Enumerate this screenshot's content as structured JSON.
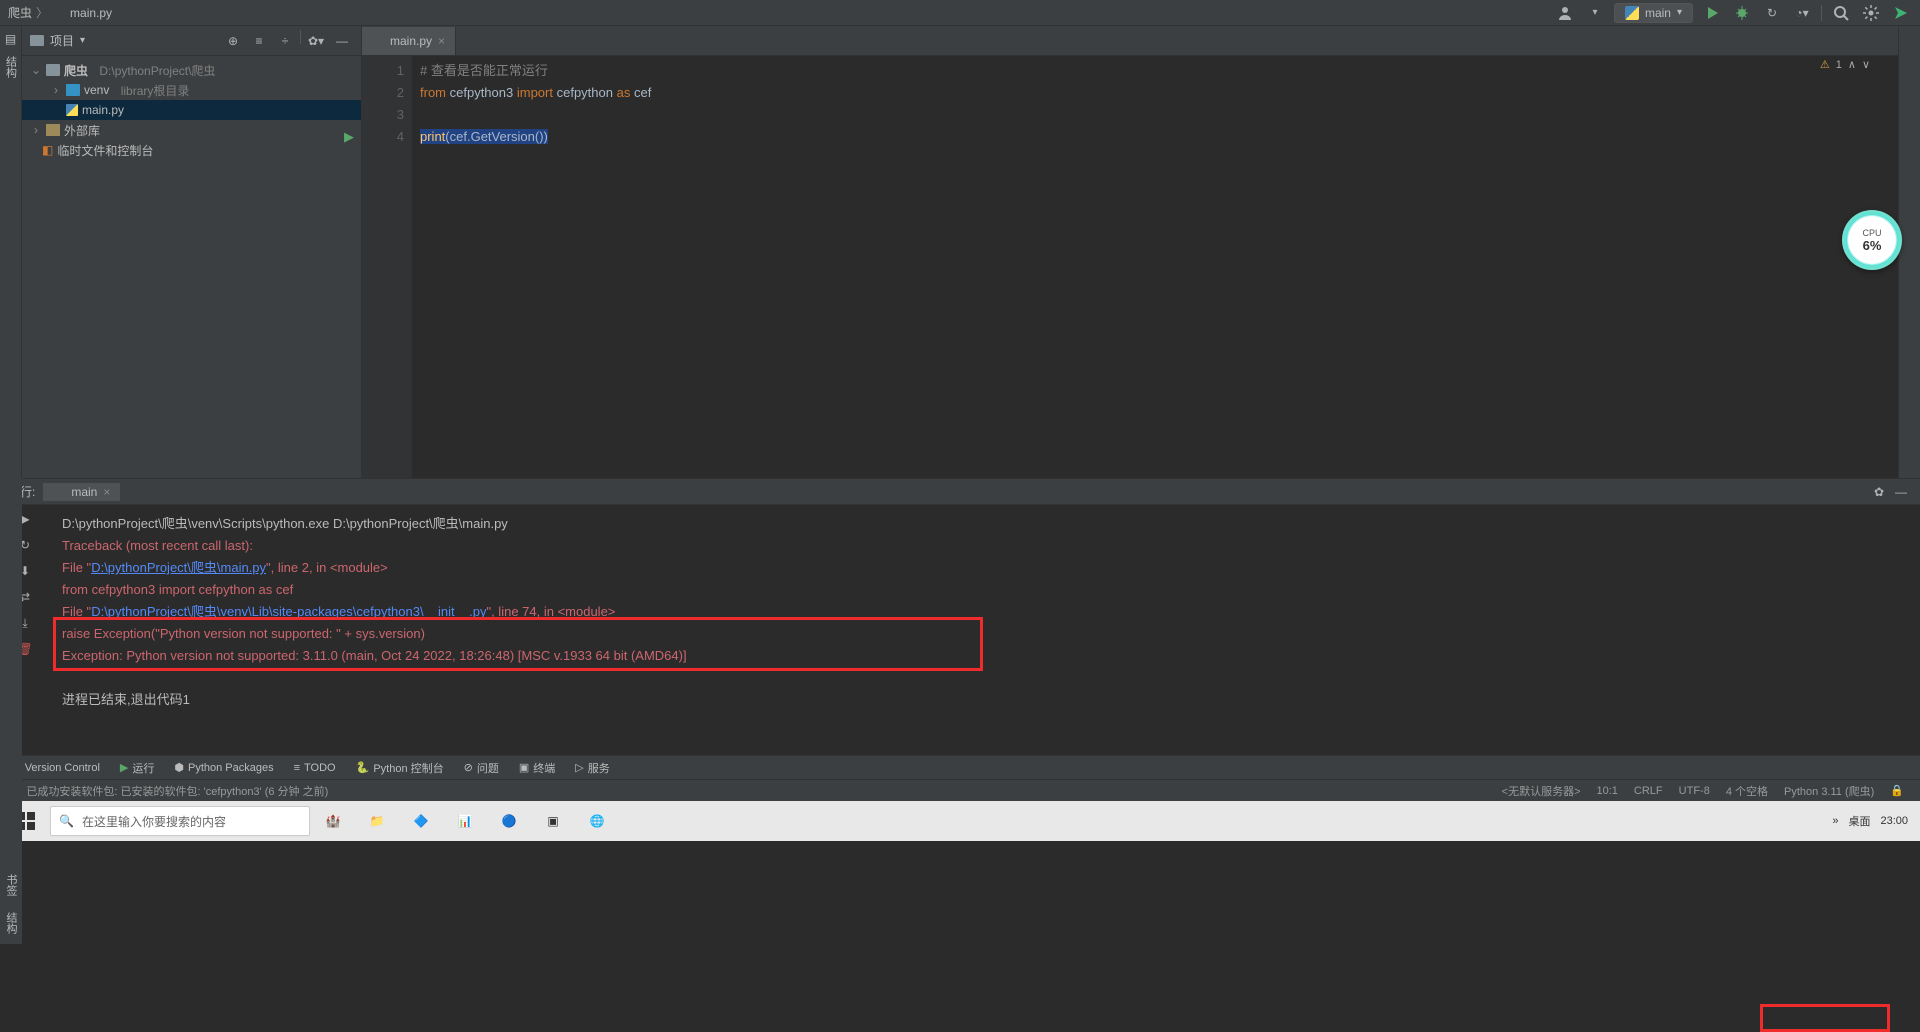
{
  "breadcrumbs": {
    "root": "爬虫",
    "file": "main.py"
  },
  "run_config": {
    "name": "main"
  },
  "project_panel": {
    "title": "项目",
    "root_name": "爬虫",
    "root_path": "D:\\pythonProject\\爬虫",
    "venv_name": "venv",
    "venv_hint": "library根目录",
    "main_file": "main.py",
    "ext_libs": "外部库",
    "scratches": "临时文件和控制台"
  },
  "tabs": {
    "active": "main.py"
  },
  "code": {
    "line1_comment": "# 查看是否能正常运行",
    "line2_from": "from",
    "line2_mod": "cefpython3",
    "line2_import": "import",
    "line2_cef": "cefpython",
    "line2_as": "as",
    "line2_alias": "cef",
    "line4_print": "print",
    "line4_expr": "(cef.GetVersion())"
  },
  "gutter": {
    "l1": "1",
    "l2": "2",
    "l3": "3",
    "l4": "4"
  },
  "inspections": {
    "warn_count": "1"
  },
  "run_panel": {
    "label": "运行:",
    "tab": "main",
    "cmd": "D:\\pythonProject\\爬虫\\venv\\Scripts\\python.exe D:\\pythonProject\\爬虫\\main.py",
    "tb": "Traceback (most recent call last):",
    "file1_pre": "  File \"",
    "file1_path": "D:\\pythonProject\\爬虫\\main.py",
    "file1_post": "\", line 2, in <module>",
    "imp": "    from cefpython3 import cefpython as cef",
    "file2_pre": "  File \"",
    "file2_path": "D:\\pythonProject\\爬虫\\venv\\Lib\\site-packages\\cefpython3\\__init__.py",
    "file2_post": "\", line 74, in <module>",
    "raise": "    raise Exception(\"Python version not supported: \" + sys.version)",
    "exc": "Exception: Python version not supported: 3.11.0 (main, Oct 24 2022, 18:26:48) [MSC v.1933 64 bit (AMD64)]",
    "exit": "进程已结束,退出代码1"
  },
  "bottom_tabs": {
    "vcs": "Version Control",
    "run": "运行",
    "pkgs": "Python Packages",
    "todo": "TODO",
    "pyconsole": "Python 控制台",
    "problems": "问题",
    "terminal": "终端",
    "services": "服务"
  },
  "status": {
    "msg": "已成功安装软件包: 已安装的软件包: 'cefpython3' (6 分钟 之前)",
    "server": "<无默认服务器>",
    "pos": "10:1",
    "eol": "CRLF",
    "enc": "UTF-8",
    "indent": "4 个空格",
    "interp": "Python 3.11 (爬虫)"
  },
  "taskbar": {
    "search_ph": "在这里输入你要搜索的内容",
    "desktop": "桌面",
    "time": "23:00"
  },
  "cpu": {
    "label": "CPU",
    "pct": "6%"
  }
}
